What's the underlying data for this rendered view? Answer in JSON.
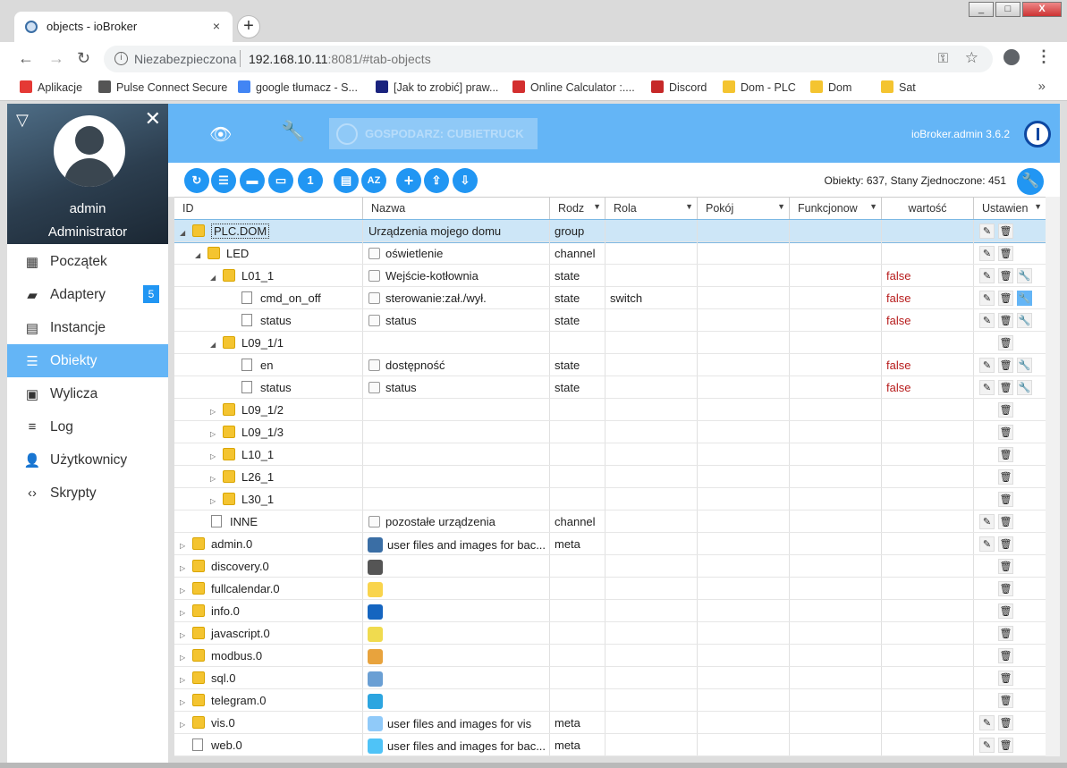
{
  "browser": {
    "tab_title": "objects - ioBroker",
    "tab_close": "×",
    "new_tab": "+",
    "security": "Niezabezpieczona",
    "url_host": "192.168.10.11",
    "url_rest": ":8081/#tab-objects",
    "win_min": "_",
    "win_max": "□",
    "win_close": "X",
    "bookmarks": [
      {
        "label": "Aplikacje",
        "color": "#e53935"
      },
      {
        "label": "Pulse Connect Secure",
        "color": "#555555"
      },
      {
        "label": "google tłumacz - S...",
        "color": "#4285f4"
      },
      {
        "label": "[Jak to zrobić] praw...",
        "color": "#1a237e"
      },
      {
        "label": "Online Calculator :....",
        "color": "#d32f2f"
      },
      {
        "label": "Discord",
        "color": "#c62828"
      },
      {
        "label": "Dom - PLC",
        "color": "#f4c430"
      },
      {
        "label": "Dom",
        "color": "#f4c430"
      },
      {
        "label": "Sat",
        "color": "#f4c430"
      }
    ],
    "bookmarks_more": "»"
  },
  "sidebar": {
    "username": "admin",
    "role": "Administrator",
    "items": [
      {
        "label": "Początek",
        "icon": "grid-icon"
      },
      {
        "label": "Adaptery",
        "icon": "store-icon",
        "badge": "5"
      },
      {
        "label": "Instancje",
        "icon": "instances-icon"
      },
      {
        "label": "Obiekty",
        "icon": "list-icon",
        "active": true
      },
      {
        "label": "Wylicza",
        "icon": "enums-icon"
      },
      {
        "label": "Log",
        "icon": "log-icon"
      },
      {
        "label": "Użytkownicy",
        "icon": "user-icon"
      },
      {
        "label": "Skrypty",
        "icon": "code-icon"
      }
    ]
  },
  "topbar": {
    "host": "GOSPODARZ: CUBIETRUCK",
    "version": "ioBroker.admin 3.6.2"
  },
  "toolbar": {
    "counts": "Obiekty: 637, Stany Zjednoczone: 451"
  },
  "columns": [
    "ID",
    "Nazwa",
    "Rodz",
    "Rola",
    "Pokój",
    "Funkcjonow",
    "wartość",
    "Ustawien"
  ],
  "rows": [
    {
      "id": "PLC.DOM",
      "name": "Urządzenia mojego domu",
      "type": "group",
      "role": "",
      "value": ""
    },
    {
      "id": "LED",
      "name": "oświetlenie",
      "type": "channel",
      "role": "",
      "value": ""
    },
    {
      "id": "L01_1",
      "name": "Wejście-kotłownia",
      "type": "state",
      "role": "",
      "value": "false"
    },
    {
      "id": "cmd_on_off",
      "name": "sterowanie:zał./wył.",
      "type": "state",
      "role": "switch",
      "value": "false"
    },
    {
      "id": "status",
      "name": "status",
      "type": "state",
      "role": "",
      "value": "false"
    },
    {
      "id": "L09_1/1",
      "name": "",
      "type": "",
      "role": "",
      "value": ""
    },
    {
      "id": "en",
      "name": "dostępność",
      "type": "state",
      "role": "",
      "value": "false"
    },
    {
      "id": "status",
      "name": "status",
      "type": "state",
      "role": "",
      "value": "false"
    },
    {
      "id": "L09_1/2",
      "name": "",
      "type": "",
      "role": "",
      "value": ""
    },
    {
      "id": "L09_1/3",
      "name": "",
      "type": "",
      "role": "",
      "value": ""
    },
    {
      "id": "L10_1",
      "name": "",
      "type": "",
      "role": "",
      "value": ""
    },
    {
      "id": "L26_1",
      "name": "",
      "type": "",
      "role": "",
      "value": ""
    },
    {
      "id": "L30_1",
      "name": "",
      "type": "",
      "role": "",
      "value": ""
    },
    {
      "id": "INNE",
      "name": "pozostałe urządzenia",
      "type": "channel",
      "role": "",
      "value": ""
    },
    {
      "id": "admin.0",
      "name": "user files and images for bac...",
      "type": "meta",
      "role": "",
      "value": ""
    },
    {
      "id": "discovery.0",
      "name": "",
      "type": "",
      "role": "",
      "value": ""
    },
    {
      "id": "fullcalendar.0",
      "name": "",
      "type": "",
      "role": "",
      "value": ""
    },
    {
      "id": "info.0",
      "name": "",
      "type": "",
      "role": "",
      "value": ""
    },
    {
      "id": "javascript.0",
      "name": "",
      "type": "",
      "role": "",
      "value": ""
    },
    {
      "id": "modbus.0",
      "name": "",
      "type": "",
      "role": "",
      "value": ""
    },
    {
      "id": "sql.0",
      "name": "",
      "type": "",
      "role": "",
      "value": ""
    },
    {
      "id": "telegram.0",
      "name": "",
      "type": "",
      "role": "",
      "value": ""
    },
    {
      "id": "vis.0",
      "name": "user files and images for vis",
      "type": "meta",
      "role": "",
      "value": ""
    },
    {
      "id": "web.0",
      "name": "user files and images for bac...",
      "type": "meta",
      "role": "",
      "value": ""
    }
  ]
}
